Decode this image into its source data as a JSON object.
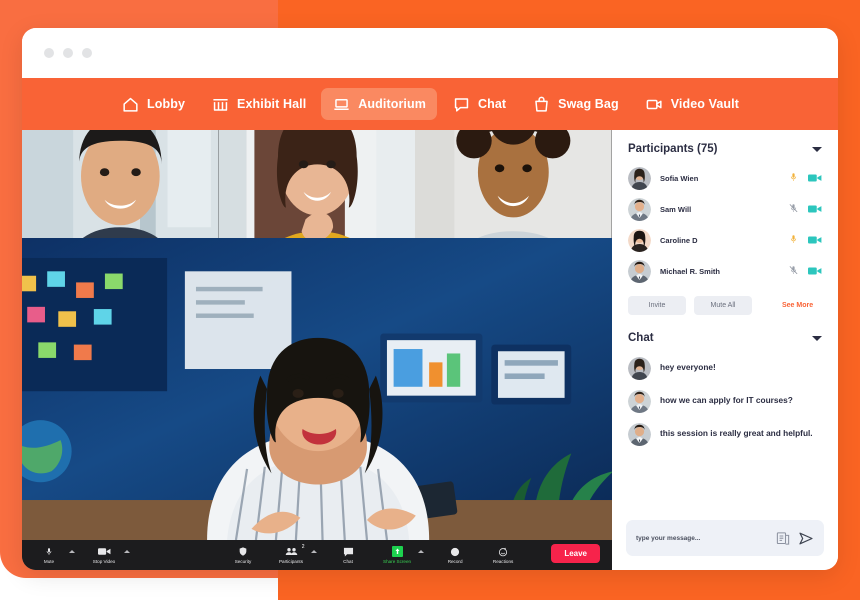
{
  "theme": {
    "orange_light": "#f96e41",
    "orange_dark": "#fa6423",
    "nav_bg": "#f96336",
    "nav_active_bg": "#fa8961",
    "accent": "#f96336",
    "leave_red": "#f7234b",
    "share_green": "#39d353",
    "mic_on": "#f2b23a",
    "mic_off": "#9aa0ab",
    "cam_on": "#2cc6bd"
  },
  "window": {
    "dots": [
      "dot-1",
      "dot-2",
      "dot-3"
    ]
  },
  "nav": {
    "items": [
      {
        "label": "Lobby",
        "icon": "home-icon",
        "active": false
      },
      {
        "label": "Exhibit Hall",
        "icon": "storefront-icon",
        "active": false
      },
      {
        "label": "Auditorium",
        "icon": "laptop-icon",
        "active": true
      },
      {
        "label": "Chat",
        "icon": "chat-bubble-icon",
        "active": false
      },
      {
        "label": "Swag Bag",
        "icon": "shopping-bag-icon",
        "active": false
      },
      {
        "label": "Video Vault",
        "icon": "video-camera-icon",
        "active": false
      }
    ]
  },
  "stage": {
    "thumbnails": [
      {
        "name": "thumbnail-participant-1"
      },
      {
        "name": "thumbnail-participant-2"
      },
      {
        "name": "thumbnail-participant-3"
      }
    ],
    "main_speaker": "main-speaker-video"
  },
  "controls": {
    "items": [
      {
        "label": "Mute",
        "icon": "microphone-icon",
        "caret": true,
        "green": false,
        "badge": ""
      },
      {
        "label": "Stop Video",
        "icon": "video-camera-icon",
        "caret": true,
        "green": false,
        "badge": ""
      },
      {
        "label": "Security",
        "icon": "shield-icon",
        "caret": false,
        "green": false,
        "badge": ""
      },
      {
        "label": "Participants",
        "icon": "people-icon",
        "caret": true,
        "green": false,
        "badge": "2"
      },
      {
        "label": "Chat",
        "icon": "chat-bubble-icon",
        "caret": false,
        "green": false,
        "badge": ""
      },
      {
        "label": "Share Screen",
        "icon": "share-screen-icon",
        "caret": true,
        "green": true,
        "badge": ""
      },
      {
        "label": "Record",
        "icon": "record-icon",
        "caret": false,
        "green": false,
        "badge": ""
      },
      {
        "label": "Reactions",
        "icon": "reactions-icon",
        "caret": false,
        "green": false,
        "badge": ""
      }
    ],
    "leave_label": "Leave"
  },
  "participants": {
    "title": "Participants (75)",
    "count": 75,
    "rows": [
      {
        "name": "Sofia Wien",
        "mic": "on",
        "camera": "on"
      },
      {
        "name": "Sam Will",
        "mic": "off",
        "camera": "on"
      },
      {
        "name": "Caroline D",
        "mic": "on",
        "camera": "on"
      },
      {
        "name": "Michael R. Smith",
        "mic": "off",
        "camera": "on"
      }
    ],
    "invite_label": "Invite",
    "mute_all_label": "Mute All",
    "see_more_label": "See More"
  },
  "chat": {
    "title": "Chat",
    "messages": [
      {
        "text": "hey everyone!",
        "avatar": "avatar-sofia"
      },
      {
        "text": "how we can apply for IT courses?",
        "avatar": "avatar-sam"
      },
      {
        "text": "this session is really great and helpful.",
        "avatar": "avatar-michael"
      }
    ],
    "input_value": "",
    "input_placeholder": "type your message..."
  }
}
